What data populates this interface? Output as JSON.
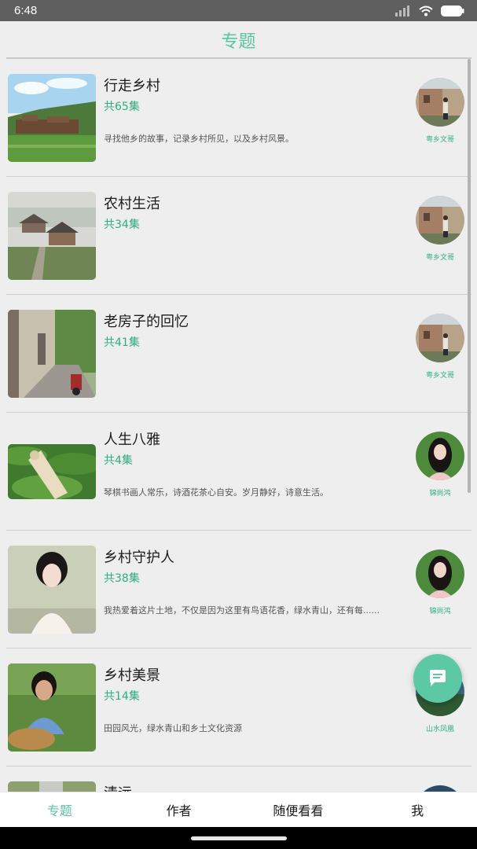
{
  "status": {
    "time": "6:48"
  },
  "header": {
    "title": "专题"
  },
  "topics": [
    {
      "title": "行走乡村",
      "count": "共65集",
      "desc": "寻找他乡的故事，记录乡村所见，以及乡村风景。",
      "author": "粤乡文哥"
    },
    {
      "title": "农村生活",
      "count": "共34集",
      "desc": "",
      "author": "粤乡文哥"
    },
    {
      "title": "老房子的回忆",
      "count": "共41集",
      "desc": "",
      "author": "粤乡文哥"
    },
    {
      "title": "人生八雅",
      "count": "共4集",
      "desc": "琴棋书画人常乐，诗酒花茶心自安。岁月静好，诗意生活。",
      "author": "锦尚鸿"
    },
    {
      "title": "乡村守护人",
      "count": "共38集",
      "desc": "我热爱着这片土地，不仅是因为这里有鸟语花香，绿水青山，还有每......",
      "author": "锦尚鸿"
    },
    {
      "title": "乡村美景",
      "count": "共14集",
      "desc": "田园风光，绿水青山和乡土文化资源",
      "author": "山水凤凰"
    },
    {
      "title": "清远",
      "count": "",
      "desc": "",
      "author": ""
    }
  ],
  "fab": {
    "icon": "chat-icon",
    "color": "#5cc9a4"
  },
  "nav": {
    "tab1": "专题",
    "tab2": "作者",
    "tab3": "随便看看",
    "tab4": "我"
  },
  "colors": {
    "accent": "#5cc4a0",
    "count_text": "#2fae7e"
  }
}
